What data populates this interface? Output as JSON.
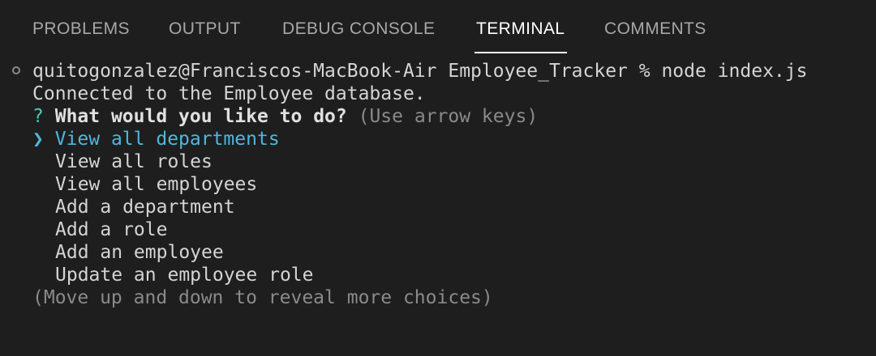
{
  "panel_tabs": [
    {
      "label": "PROBLEMS",
      "active": false
    },
    {
      "label": "OUTPUT",
      "active": false
    },
    {
      "label": "DEBUG CONSOLE",
      "active": false
    },
    {
      "label": "TERMINAL",
      "active": true
    },
    {
      "label": "COMMENTS",
      "active": false
    }
  ],
  "terminal": {
    "command_line": "quitogonzalez@Franciscos-MacBook-Air Employee_Tracker % node index.js",
    "status_line": "Connected to the Employee database.",
    "prompt_mark": "?",
    "prompt_question": "What would you like to do?",
    "prompt_hint": "(Use arrow keys)",
    "pointer": "❯",
    "choices": [
      {
        "label": "View all departments",
        "selected": true
      },
      {
        "label": "View all roles",
        "selected": false
      },
      {
        "label": "View all employees",
        "selected": false
      },
      {
        "label": "Add a department",
        "selected": false
      },
      {
        "label": "Add a role",
        "selected": false
      },
      {
        "label": "Add an employee",
        "selected": false
      },
      {
        "label": "Update an employee role",
        "selected": false
      }
    ],
    "footer_hint": "(Move up and down to reveal more choices)"
  },
  "colors": {
    "background": "#1e1e1e",
    "tab_inactive": "#a7a7a7",
    "tab_active": "#ffffff",
    "prompt_mark": "#4ec9b0",
    "selected_choice": "#4fb6df",
    "hint": "#8a8a8a"
  }
}
